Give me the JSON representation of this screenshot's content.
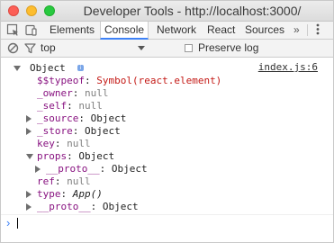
{
  "window": {
    "title": "Developer Tools - http://localhost:3000/"
  },
  "tabs": [
    {
      "label": "Elements"
    },
    {
      "label": "Console"
    },
    {
      "label": "Network"
    },
    {
      "label": "React"
    },
    {
      "label": "Sources"
    }
  ],
  "overflow_label": "»",
  "filter": {
    "context": "top",
    "preserve_log": "Preserve log"
  },
  "console": {
    "source_link": "index.js:6",
    "root": {
      "label": "Object",
      "badge": "i"
    },
    "entries": [
      {
        "key": "$$typeof",
        "value": "Symbol(react.element)"
      },
      {
        "key": "_owner",
        "value": "null"
      },
      {
        "key": "_self",
        "value": "null"
      },
      {
        "key": "_source",
        "value": "Object"
      },
      {
        "key": "_store",
        "value": "Object"
      },
      {
        "key": "key",
        "value": "null"
      },
      {
        "key": "props",
        "value": "Object"
      },
      {
        "key": "__proto__",
        "value": "Object"
      },
      {
        "key": "ref",
        "value": "null"
      },
      {
        "key": "type",
        "value": "App()"
      },
      {
        "key": "__proto__",
        "value": "Object"
      }
    ],
    "prompt": "›"
  },
  "colors": {
    "accent": "#3e82f7",
    "key": "#881280",
    "symbol": "#c41a16",
    "null": "#808080"
  },
  "icons": [
    "inspect-icon",
    "device-toolbar-icon",
    "clear-console-icon",
    "filter-icon",
    "overflow-menu-icon"
  ]
}
